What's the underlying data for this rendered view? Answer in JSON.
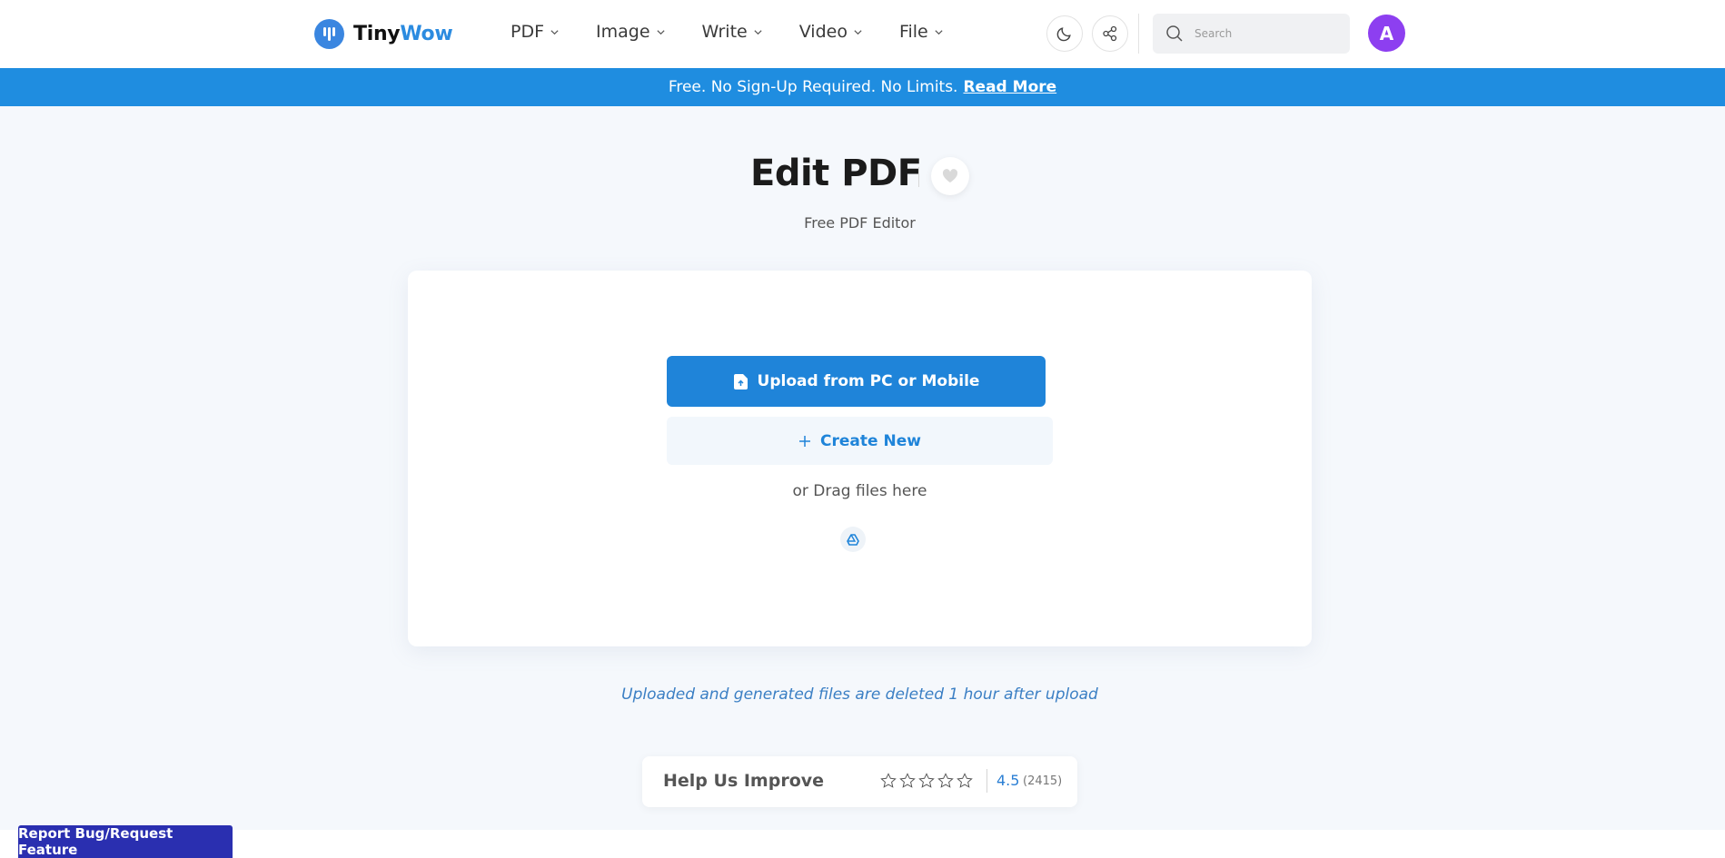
{
  "header": {
    "logo": {
      "tiny": "Tiny",
      "wow": "Wow"
    },
    "nav": [
      {
        "label": "PDF"
      },
      {
        "label": "Image"
      },
      {
        "label": "Write"
      },
      {
        "label": "Video"
      },
      {
        "label": "File"
      }
    ],
    "search": {
      "placeholder": "Search"
    },
    "avatar_initial": "A"
  },
  "banner": {
    "text": "Free. No Sign-Up Required. No Limits.",
    "link": "Read More"
  },
  "page": {
    "title": "Edit PDF",
    "subtitle": "Free PDF Editor"
  },
  "upload": {
    "upload_label": "Upload from PC or Mobile",
    "create_label": "Create New",
    "drag_text": "or Drag files here"
  },
  "notice": "Uploaded and generated files are deleted 1 hour after upload",
  "rating": {
    "label": "Help Us Improve",
    "score": "4.5",
    "count": "(2415)",
    "stars": 5
  },
  "report_button": "Report Bug/Request Feature",
  "colors": {
    "brand_blue": "#1f84d9",
    "banner_blue": "#1f8de0",
    "avatar_purple": "#8d3ff0",
    "report_indigo": "#2a2fb0"
  },
  "icons": {
    "logo": "tinywow-logo-icon",
    "dark_mode": "moon-icon",
    "share": "share-icon",
    "search": "search-icon",
    "favorite": "heart-icon",
    "upload": "file-upload-icon",
    "create": "plus-icon",
    "drive": "google-drive-icon",
    "star": "star-outline-icon"
  }
}
